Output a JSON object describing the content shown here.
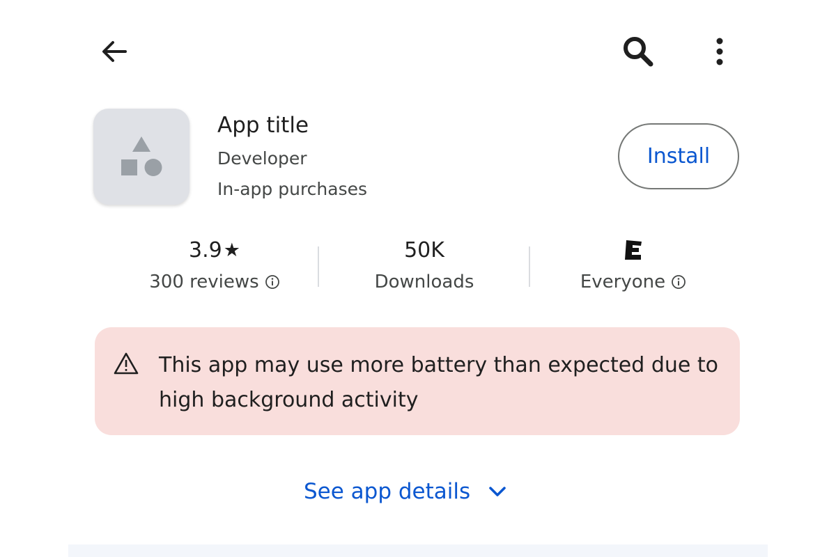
{
  "app": {
    "title": "App title",
    "developer": "Developer",
    "purchases": "In-app purchases",
    "install_label": "Install"
  },
  "stats": {
    "rating": {
      "value": "3.9",
      "star": "★",
      "label": "300 reviews"
    },
    "downloads": {
      "value": "50K",
      "label": "Downloads"
    },
    "content_rating": {
      "badge": "E",
      "label": "Everyone"
    }
  },
  "warning": {
    "text": "This app may use more battery than expected due to high background activity"
  },
  "details_link": {
    "label": "See app details"
  },
  "colors": {
    "accent": "#0b57d0",
    "warning_bg": "#f9dedc",
    "icon_bg": "#dfe1e6",
    "text_primary": "#1f1f1f",
    "text_secondary": "#444746"
  },
  "icons": {
    "back": "back-arrow-icon",
    "search": "search-icon",
    "more": "more-vert-icon",
    "info": "info-icon",
    "warning": "warning-icon",
    "chevron": "chevron-down-icon"
  }
}
